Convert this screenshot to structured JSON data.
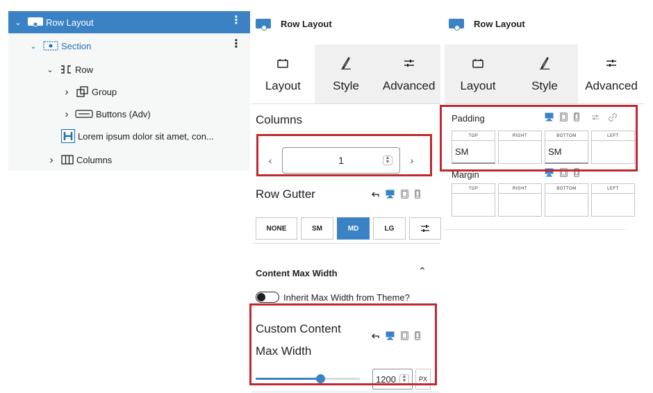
{
  "list_view": {
    "items": [
      {
        "label": "Row Layout",
        "chevron": "⌄",
        "icon": "row-layout-icon",
        "selected": true,
        "more": "⋮"
      },
      {
        "label": "Section",
        "chevron": "⌄",
        "icon": "section-icon",
        "more": "⋮"
      },
      {
        "label": "Row",
        "chevron": "⌄",
        "icon": "row-icon"
      },
      {
        "label": "Group",
        "chevron": "›",
        "icon": "group-icon"
      },
      {
        "label": "Buttons (Adv)",
        "chevron": "›",
        "icon": "buttons-icon"
      },
      {
        "label": "Lorem ipsum dolor sit amet, con...",
        "chevron": "",
        "icon": "heading-icon"
      },
      {
        "label": "Columns",
        "chevron": "›",
        "icon": "columns-icon"
      }
    ]
  },
  "panel_layout": {
    "title": "Row Layout",
    "tabs": [
      {
        "label": "Layout",
        "icon": "layout-tab-icon",
        "active": true
      },
      {
        "label": "Style",
        "icon": "style-brush-icon",
        "active": false
      },
      {
        "label": "Advanced",
        "icon": "advanced-sliders-icon",
        "active": false
      }
    ],
    "columns": {
      "heading": "Columns",
      "prev": "‹",
      "next": "›",
      "value": "1"
    },
    "row_gutter": {
      "heading": "Row Gutter",
      "options": [
        "NONE",
        "SM",
        "MD",
        "LG"
      ],
      "active": "MD"
    },
    "content_max_width": {
      "heading": "Content Max Width",
      "chevron": "⌃",
      "toggle_label": "Inherit Max Width from Theme?",
      "toggle_on": false
    },
    "custom_max_width": {
      "heading": "Custom Content Max Width",
      "value": "1200",
      "unit": "PX",
      "slider_fraction": 0.62
    }
  },
  "panel_adv": {
    "title": "Row Layout",
    "tabs": [
      {
        "label": "Layout",
        "icon": "layout-tab-icon",
        "active": false
      },
      {
        "label": "Style",
        "icon": "style-brush-icon",
        "active": false
      },
      {
        "label": "Advanced",
        "icon": "advanced-sliders-icon",
        "active": true
      }
    ],
    "padding": {
      "heading": "Padding",
      "sides": [
        {
          "label": "TOP",
          "value": "SM"
        },
        {
          "label": "RIGHT",
          "value": ""
        },
        {
          "label": "BOTTOM",
          "value": "SM"
        },
        {
          "label": "LEFT",
          "value": ""
        }
      ]
    },
    "margin": {
      "heading": "Margin",
      "sides": [
        {
          "label": "TOP",
          "value": ""
        },
        {
          "label": "RIGHT",
          "value": ""
        },
        {
          "label": "BOTTOM",
          "value": ""
        },
        {
          "label": "LEFT",
          "value": ""
        }
      ]
    }
  },
  "colors": {
    "accent": "#3a82c4",
    "highlight": "#c0282d"
  }
}
